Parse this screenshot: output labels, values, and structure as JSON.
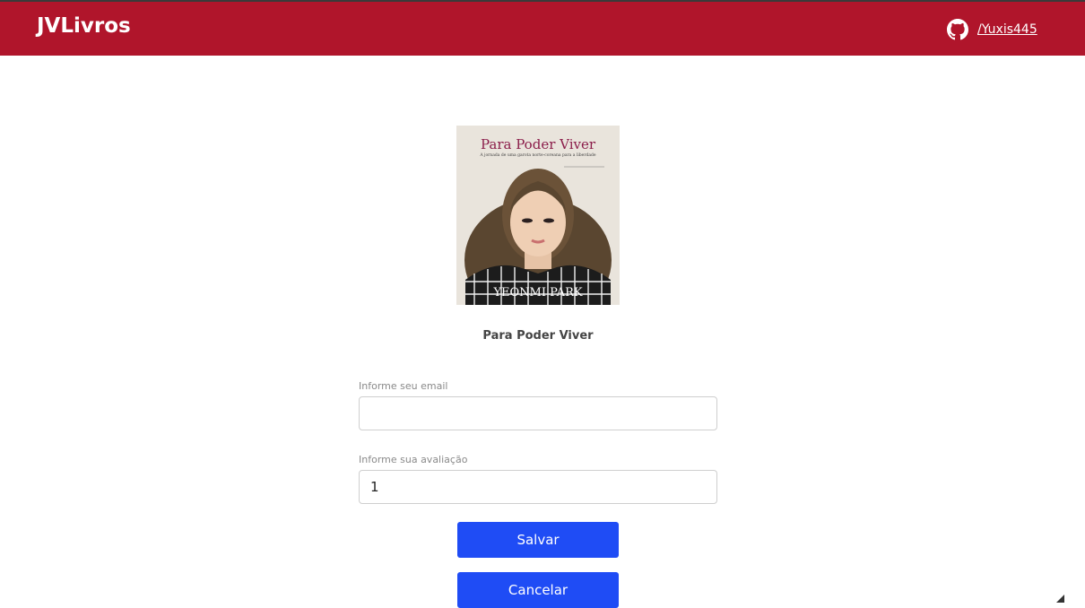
{
  "header": {
    "brand": "JVLivros",
    "github_label": "/Yuxis445",
    "background_color": "#b0152b"
  },
  "book": {
    "cover_title": "Para Poder Viver",
    "cover_subtitle": "A jornada de uma garota norte-coreana para a liberdade",
    "cover_author": "YEONMI PARK",
    "title": "Para Poder Viver"
  },
  "form": {
    "email_label": "Informe seu email",
    "email_value": "",
    "rating_label": "Informe sua avaliação",
    "rating_value": "1",
    "save_label": "Salvar",
    "cancel_label": "Cancelar",
    "button_color": "#1f4cf5"
  },
  "icons": {
    "github": "github-icon"
  }
}
